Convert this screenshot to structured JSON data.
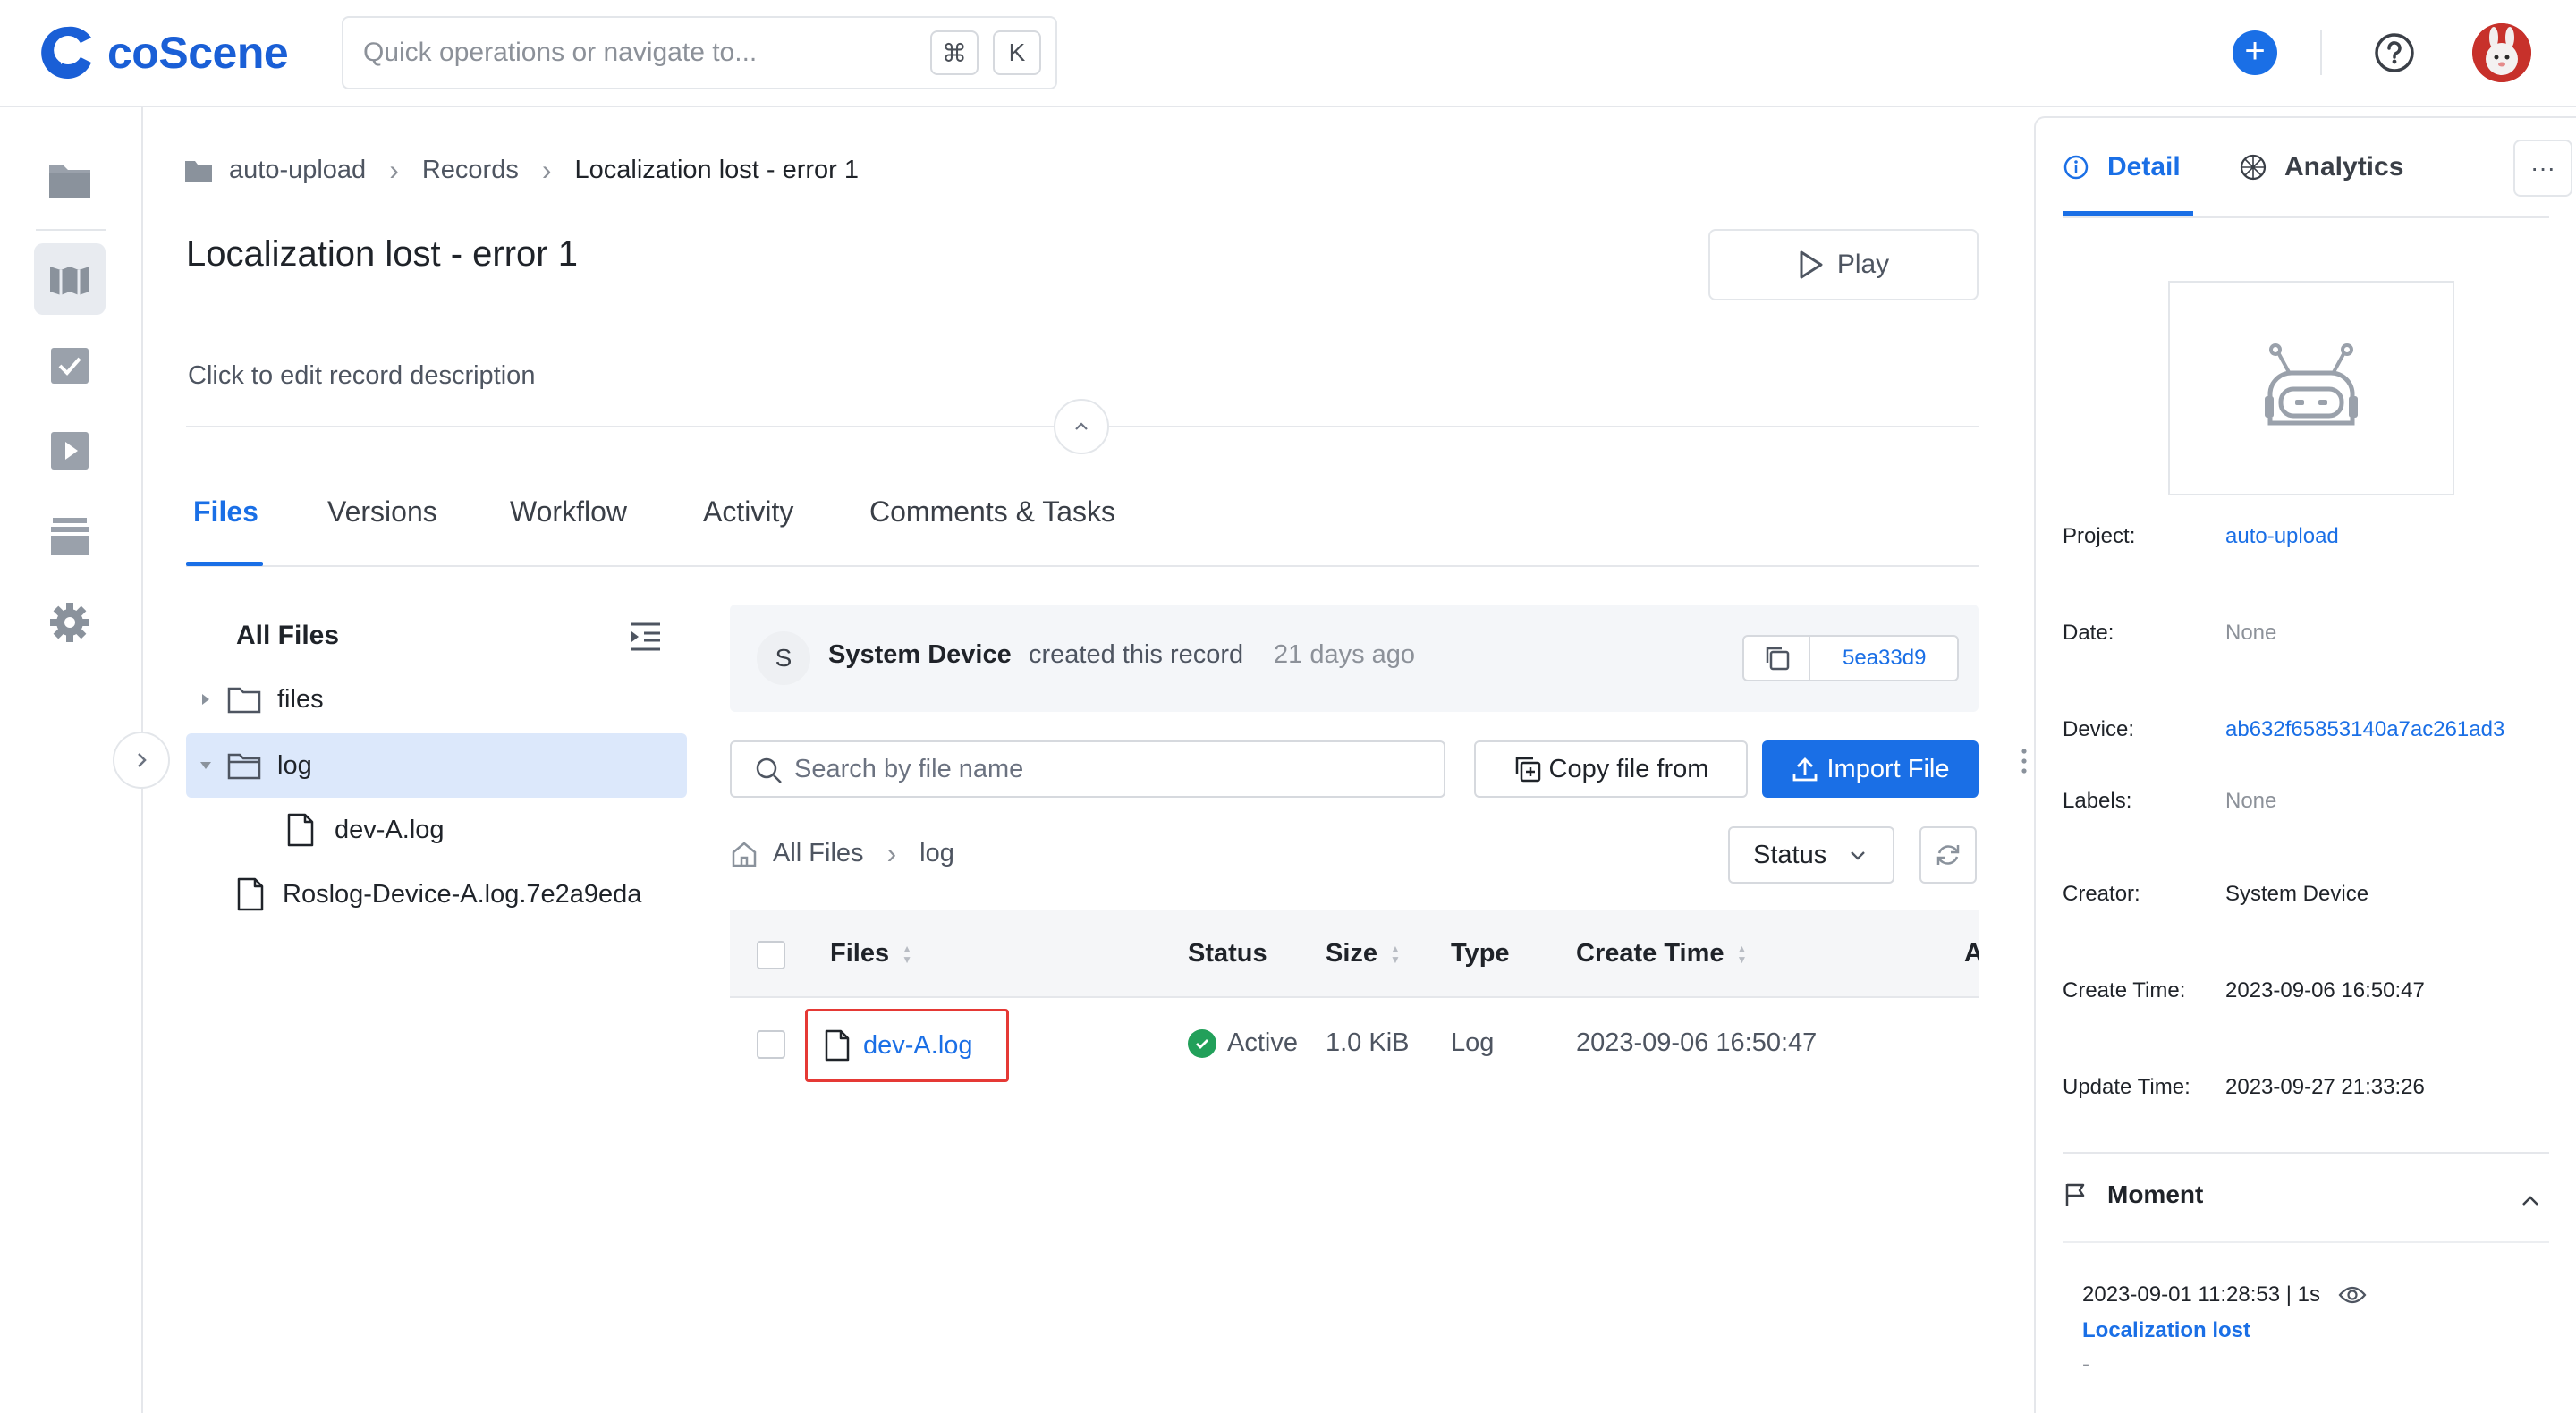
{
  "header": {
    "logo_text": "coScene",
    "search_placeholder": "Quick operations or navigate to...",
    "shortcut_mod": "⌘",
    "shortcut_key": "K",
    "add_label": "+"
  },
  "breadcrumb": {
    "items": [
      "auto-upload",
      "Records",
      "Localization lost - error 1"
    ]
  },
  "record": {
    "title": "Localization lost - error 1",
    "play_label": "Play",
    "description_placeholder": "Click to edit record description"
  },
  "tabs": [
    "Files",
    "Versions",
    "Workflow",
    "Activity",
    "Comments & Tasks"
  ],
  "tree": {
    "header": "All Files",
    "items": [
      {
        "label": "files"
      },
      {
        "label": "log"
      },
      {
        "label": "dev-A.log"
      },
      {
        "label": "Roslog-Device-A.log.7e2a9eda"
      }
    ]
  },
  "created": {
    "avatar_letter": "S",
    "user": "System Device",
    "action": "created this record",
    "time": "21 days ago",
    "hash": "5ea33d9"
  },
  "toolbar": {
    "search_placeholder": "Search by file name",
    "copy_label": "Copy file from",
    "import_label": "Import File",
    "status_label": "Status"
  },
  "path": {
    "root": "All Files",
    "current": "log"
  },
  "table": {
    "columns": [
      "Files",
      "Status",
      "Size",
      "Type",
      "Create Time",
      "A"
    ],
    "rows": [
      {
        "name": "dev-A.log",
        "status": "Active",
        "size": "1.0 KiB",
        "type": "Log",
        "create_time": "2023-09-06 16:50:47"
      }
    ]
  },
  "detail": {
    "tab_detail": "Detail",
    "tab_analytics": "Analytics",
    "more_label": "···",
    "fields": {
      "project_label": "Project:",
      "project": "auto-upload",
      "date_label": "Date:",
      "date": "None",
      "device_label": "Device:",
      "device": "ab632f65853140a7ac261ad3",
      "labels_label": "Labels:",
      "labels": "None",
      "creator_label": "Creator:",
      "creator": "System Device",
      "create_time_label": "Create Time:",
      "create_time": "2023-09-06 16:50:47",
      "update_time_label": "Update Time:",
      "update_time": "2023-09-27 21:33:26"
    },
    "moment": {
      "header": "Moment",
      "time": "2023-09-01 11:28:53 | 1s",
      "name": "Localization lost",
      "note": "-"
    }
  },
  "colors": {
    "accent": "#1a6fe6",
    "active_status": "#22a05a",
    "highlight_border": "#e53935",
    "selected_tree_bg": "#dce8fb"
  }
}
